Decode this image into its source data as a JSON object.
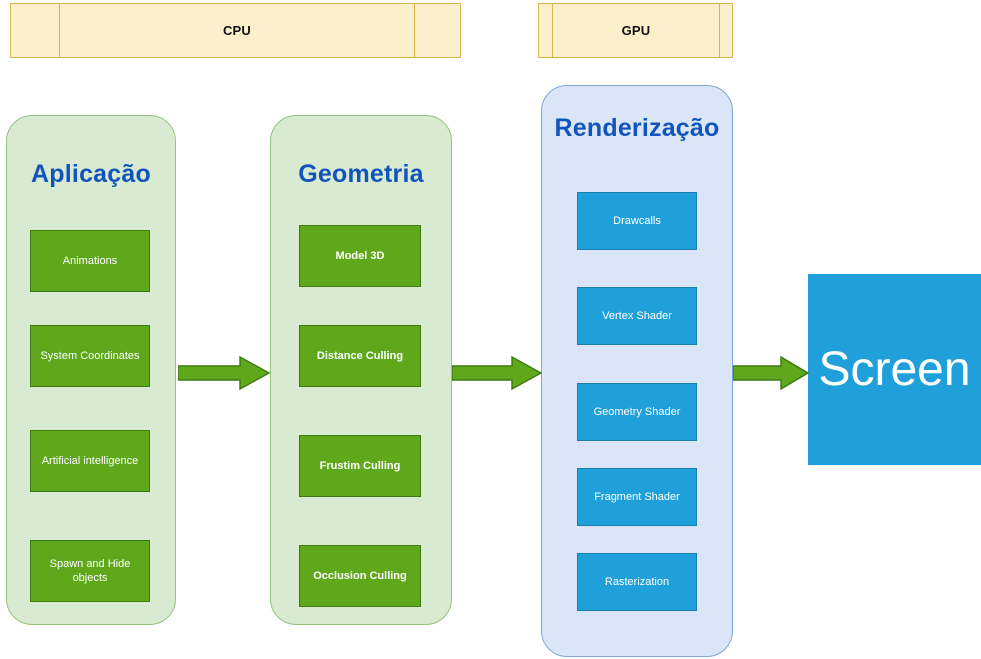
{
  "headers": [
    {
      "id": "cpu",
      "label": "CPU"
    },
    {
      "id": "gpu",
      "label": "GPU"
    }
  ],
  "stages": [
    {
      "id": "application",
      "title": "Aplicação",
      "items": [
        {
          "label": "Animations"
        },
        {
          "label": "System Coordinates"
        },
        {
          "label": "Artificial intelligence"
        },
        {
          "label": "Spawn and Hide objects"
        }
      ]
    },
    {
      "id": "geometry",
      "title": "Geometria",
      "items": [
        {
          "label": "Model 3D"
        },
        {
          "label": "Distance Culling"
        },
        {
          "label": "Frustim Culling"
        },
        {
          "label": "Occlusion Culling"
        }
      ]
    },
    {
      "id": "rendering",
      "title": "Renderização",
      "items": [
        {
          "label": "Drawcalls"
        },
        {
          "label": "Vertex Shader"
        },
        {
          "label": "Geometry Shader"
        },
        {
          "label": "Fragment Shader"
        },
        {
          "label": "Rasterization"
        }
      ]
    }
  ],
  "output": {
    "label": "Screen"
  },
  "arrows": [
    {
      "id": "app-to-geometry",
      "name": "arrow-application-to-geometry"
    },
    {
      "id": "geometry-to-rendering",
      "name": "arrow-geometry-to-rendering"
    },
    {
      "id": "rendering-to-screen",
      "name": "arrow-rendering-to-screen"
    }
  ],
  "colors": {
    "header_fill": "#FCEFCB",
    "header_border": "#D9B44A",
    "stage_green_fill": "#D9EAD3",
    "stage_green_border": "#93C47D",
    "stage_blue_fill": "#DAE6F7",
    "stage_blue_border": "#7EA6D9",
    "item_green": "#5FA81C",
    "item_green_border": "#3D7A10",
    "item_blue": "#20A0DB",
    "item_blue_border": "#1A7FB0",
    "title_text": "#1155BB",
    "arrow_fill": "#5FA81C",
    "arrow_border": "#3D7A10",
    "screen_fill": "#20A0DB"
  }
}
